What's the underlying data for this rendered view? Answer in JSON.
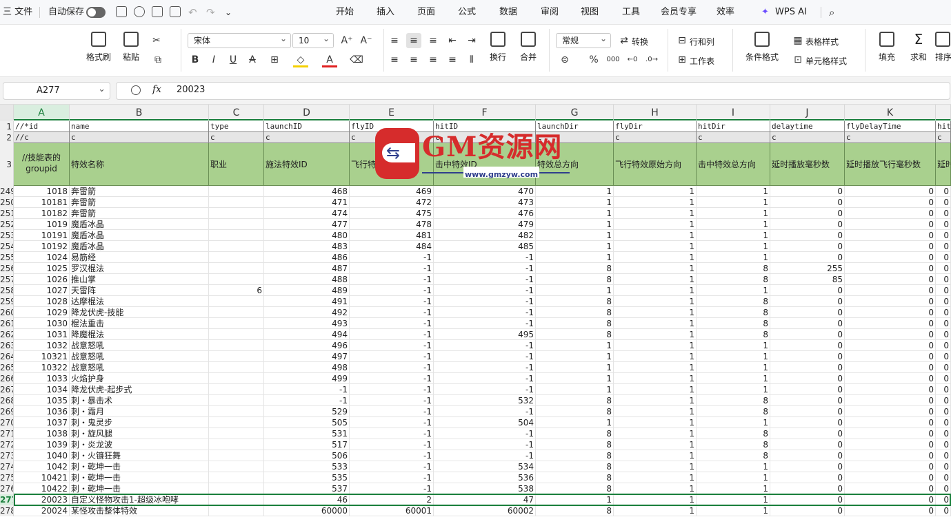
{
  "topbar": {
    "menu_label": "三 文件",
    "autosave_label": "自动保存",
    "tabs": [
      "开始",
      "插入",
      "页面",
      "公式",
      "数据",
      "审阅",
      "视图",
      "工具",
      "会员专享",
      "效率"
    ],
    "active_tab": "开始",
    "ai_label": "WPS AI",
    "accent": "#1a7f3c"
  },
  "ribbon": {
    "format_painter": "格式刷",
    "paste": "粘贴",
    "font_name": "宋体",
    "font_size": "10",
    "wrap": "换行",
    "merge": "合并",
    "number_format": "常规",
    "convert": "转换",
    "rows_cols": "行和列",
    "worksheet": "工作表",
    "cond_format": "条件格式",
    "table_style": "表格样式",
    "cell_style": "单元格样式",
    "fill": "填充",
    "sum": "求和",
    "sort": "排序"
  },
  "formula_bar": {
    "name_box": "A277",
    "fx": "fx",
    "value": "20023"
  },
  "columns": [
    "A",
    "B",
    "C",
    "D",
    "E",
    "F",
    "G",
    "H",
    "I",
    "J",
    "K"
  ],
  "header_rows": {
    "row_numbers": [
      "1",
      "2",
      "3"
    ],
    "r1": [
      "//*id",
      "name",
      "type",
      "launchID",
      "flyID",
      "hitID",
      "launchDir",
      "flyDir",
      "hitDir",
      "delaytime",
      "flyDelayTime",
      "hit"
    ],
    "r2": [
      "//c",
      "c",
      "c",
      "c",
      "c",
      "c",
      "c",
      "c",
      "c",
      "c",
      "c",
      "c"
    ],
    "r3": [
      "//技能表的groupid",
      "特效名称",
      "职业",
      "施法特效ID",
      "飞行特效ID",
      "击中特效ID",
      "特效总方向",
      "飞行特效原始方向",
      "击中特效总方向",
      "延时播放毫秒数",
      "延时播放飞行毫秒数",
      "延时"
    ]
  },
  "rows": [
    {
      "n": "249",
      "c": [
        "1018",
        "奔雷箭",
        "",
        "468",
        "469",
        "470",
        "1",
        "1",
        "1",
        "0",
        "0"
      ]
    },
    {
      "n": "250",
      "c": [
        "10181",
        "奔雷箭",
        "",
        "471",
        "472",
        "473",
        "1",
        "1",
        "1",
        "0",
        "0"
      ]
    },
    {
      "n": "251",
      "c": [
        "10182",
        "奔雷箭",
        "",
        "474",
        "475",
        "476",
        "1",
        "1",
        "1",
        "0",
        "0"
      ]
    },
    {
      "n": "252",
      "c": [
        "1019",
        "魔盾冰晶",
        "",
        "477",
        "478",
        "479",
        "1",
        "1",
        "1",
        "0",
        "0"
      ]
    },
    {
      "n": "253",
      "c": [
        "10191",
        "魔盾冰晶",
        "",
        "480",
        "481",
        "482",
        "1",
        "1",
        "1",
        "0",
        "0"
      ]
    },
    {
      "n": "254",
      "c": [
        "10192",
        "魔盾冰晶",
        "",
        "483",
        "484",
        "485",
        "1",
        "1",
        "1",
        "0",
        "0"
      ]
    },
    {
      "n": "255",
      "c": [
        "1024",
        "易筋经",
        "",
        "486",
        "-1",
        "-1",
        "1",
        "1",
        "1",
        "0",
        "0"
      ]
    },
    {
      "n": "256",
      "c": [
        "1025",
        "罗汉棍法",
        "",
        "487",
        "-1",
        "-1",
        "8",
        "1",
        "8",
        "255",
        "0"
      ]
    },
    {
      "n": "257",
      "c": [
        "1026",
        "推山掌",
        "",
        "488",
        "-1",
        "-1",
        "8",
        "1",
        "8",
        "85",
        "0"
      ]
    },
    {
      "n": "258",
      "c": [
        "1027",
        "天雷阵",
        "6",
        "489",
        "-1",
        "-1",
        "1",
        "1",
        "1",
        "0",
        "0"
      ]
    },
    {
      "n": "259",
      "c": [
        "1028",
        "达摩棍法",
        "",
        "491",
        "-1",
        "-1",
        "8",
        "1",
        "8",
        "0",
        "0"
      ]
    },
    {
      "n": "260",
      "c": [
        "1029",
        "降龙伏虎-技能",
        "",
        "492",
        "-1",
        "-1",
        "8",
        "1",
        "8",
        "0",
        "0"
      ]
    },
    {
      "n": "261",
      "c": [
        "1030",
        "棍法重击",
        "",
        "493",
        "-1",
        "-1",
        "8",
        "1",
        "8",
        "0",
        "0"
      ]
    },
    {
      "n": "262",
      "c": [
        "1031",
        "降魔棍法",
        "",
        "494",
        "-1",
        "495",
        "8",
        "1",
        "8",
        "0",
        "0"
      ]
    },
    {
      "n": "263",
      "c": [
        "1032",
        "战意怒吼",
        "",
        "496",
        "-1",
        "-1",
        "1",
        "1",
        "1",
        "0",
        "0"
      ]
    },
    {
      "n": "264",
      "c": [
        "10321",
        "战意怒吼",
        "",
        "497",
        "-1",
        "-1",
        "1",
        "1",
        "1",
        "0",
        "0"
      ]
    },
    {
      "n": "265",
      "c": [
        "10322",
        "战意怒吼",
        "",
        "498",
        "-1",
        "-1",
        "1",
        "1",
        "1",
        "0",
        "0"
      ]
    },
    {
      "n": "266",
      "c": [
        "1033",
        "火焰护身",
        "",
        "499",
        "-1",
        "-1",
        "1",
        "1",
        "1",
        "0",
        "0"
      ]
    },
    {
      "n": "267",
      "c": [
        "1034",
        "降龙伏虎-起步式",
        "",
        "-1",
        "-1",
        "-1",
        "1",
        "1",
        "1",
        "0",
        "0"
      ]
    },
    {
      "n": "268",
      "c": [
        "1035",
        "刺・暴击术",
        "",
        "-1",
        "-1",
        "532",
        "8",
        "1",
        "8",
        "0",
        "0"
      ]
    },
    {
      "n": "269",
      "c": [
        "1036",
        "刺・霜月",
        "",
        "529",
        "-1",
        "-1",
        "8",
        "1",
        "8",
        "0",
        "0"
      ]
    },
    {
      "n": "270",
      "c": [
        "1037",
        "刺・鬼灵步",
        "",
        "505",
        "-1",
        "504",
        "1",
        "1",
        "1",
        "0",
        "0"
      ]
    },
    {
      "n": "271",
      "c": [
        "1038",
        "刺・旋风腿",
        "",
        "531",
        "-1",
        "-1",
        "8",
        "1",
        "8",
        "0",
        "0"
      ]
    },
    {
      "n": "272",
      "c": [
        "1039",
        "刺・炎龙波",
        "",
        "517",
        "-1",
        "-1",
        "8",
        "1",
        "8",
        "0",
        "0"
      ]
    },
    {
      "n": "273",
      "c": [
        "1040",
        "刺・火镰狂舞",
        "",
        "506",
        "-1",
        "-1",
        "8",
        "1",
        "8",
        "0",
        "0"
      ]
    },
    {
      "n": "274",
      "c": [
        "1042",
        "刺・乾坤一击",
        "",
        "533",
        "-1",
        "534",
        "8",
        "1",
        "1",
        "0",
        "0"
      ]
    },
    {
      "n": "275",
      "c": [
        "10421",
        "刺・乾坤一击",
        "",
        "535",
        "-1",
        "536",
        "8",
        "1",
        "1",
        "0",
        "0"
      ]
    },
    {
      "n": "276",
      "c": [
        "10422",
        "刺・乾坤一击",
        "",
        "537",
        "-1",
        "538",
        "8",
        "1",
        "1",
        "0",
        "0"
      ]
    },
    {
      "n": "277",
      "c": [
        "20023",
        "自定义怪物攻击1-超级冰咆哮",
        "",
        "46",
        "2",
        "47",
        "1",
        "1",
        "1",
        "0",
        "0"
      ]
    },
    {
      "n": "278",
      "c": [
        "20024",
        "某怪攻击整体特效",
        "",
        "60000",
        "60001",
        "60002",
        "8",
        "1",
        "1",
        "0",
        "0"
      ]
    }
  ],
  "last_col_values": "0",
  "watermark": {
    "title": "GM资源网",
    "url": "www.gmzyw.com"
  }
}
